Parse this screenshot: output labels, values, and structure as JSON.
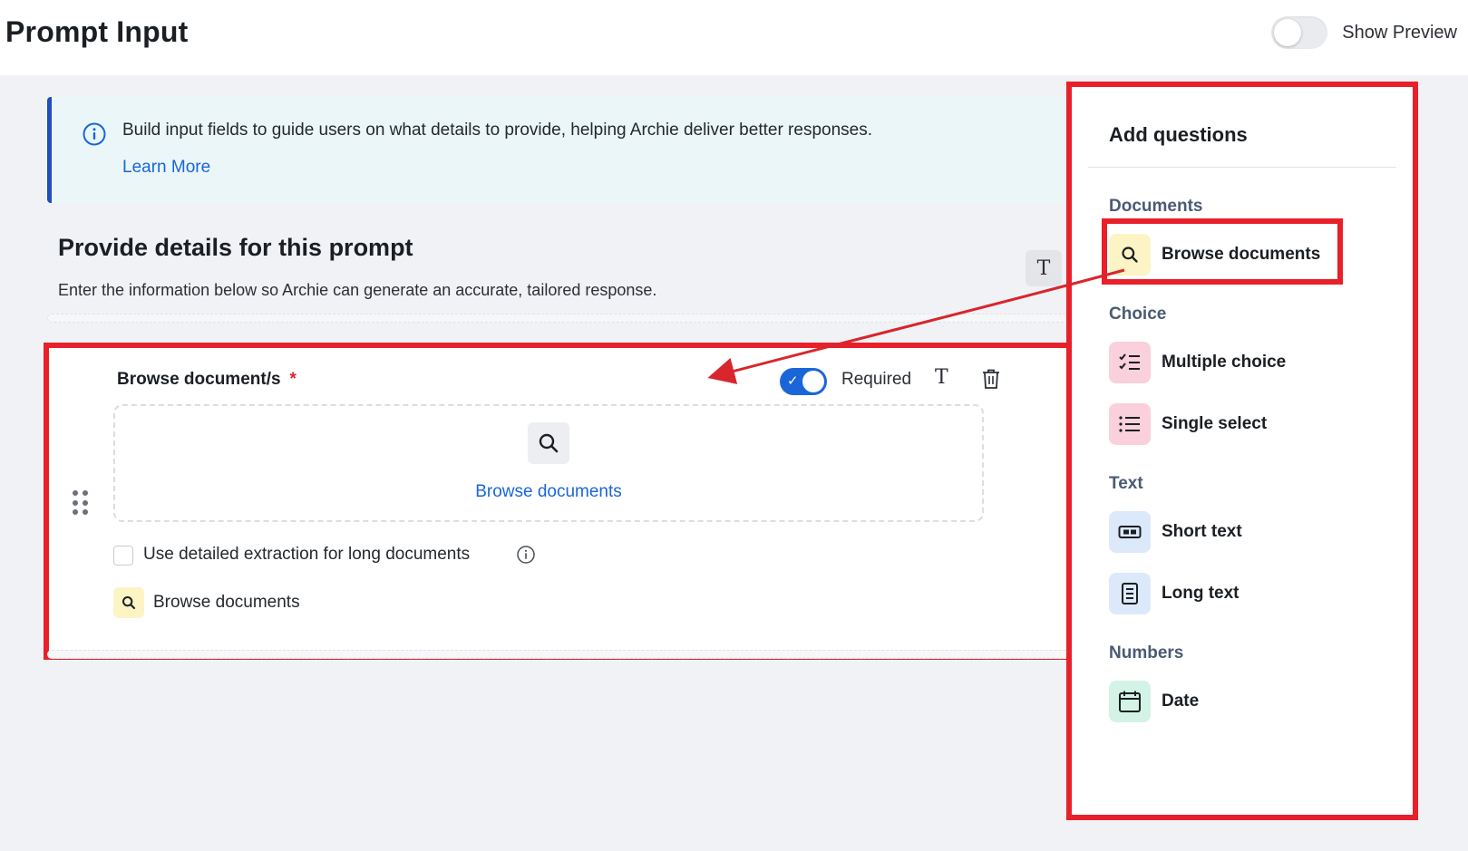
{
  "header": {
    "title": "Prompt Input",
    "preview_label": "Show Preview",
    "preview_enabled": false
  },
  "info_banner": {
    "text": "Build input fields to guide users on what details to provide, helping Archie deliver better responses.",
    "link": "Learn More"
  },
  "section": {
    "title": "Provide details for this prompt",
    "subtitle": "Enter the information below so Archie can generate an accurate, tailored response.",
    "format_button": "T"
  },
  "question": {
    "label": "Browse document/s",
    "required_marker": "*",
    "required_label": "Required",
    "required_on": true,
    "format_icon": "T",
    "drop_zone_link": "Browse documents",
    "checkbox_label": "Use detailed extraction for long documents",
    "checkbox_checked": false,
    "type_chip_label": "Browse documents"
  },
  "panel": {
    "title": "Add questions",
    "categories": [
      {
        "name": "Documents",
        "items": [
          {
            "label": "Browse documents",
            "icon": "search-icon",
            "color": "#fcf4c4"
          }
        ]
      },
      {
        "name": "Choice",
        "items": [
          {
            "label": "Multiple choice",
            "icon": "checklist-icon",
            "color": "#f9d0dc"
          },
          {
            "label": "Single select",
            "icon": "list-icon",
            "color": "#f9d0dc"
          }
        ]
      },
      {
        "name": "Text",
        "items": [
          {
            "label": "Short text",
            "icon": "text-field-icon",
            "color": "#dce9fb"
          },
          {
            "label": "Long text",
            "icon": "document-icon",
            "color": "#dce9fb"
          }
        ]
      },
      {
        "name": "Numbers",
        "items": [
          {
            "label": "Date",
            "icon": "calendar-icon",
            "color": "#d3f3e6"
          }
        ]
      }
    ]
  },
  "colors": {
    "accent": "#1a66d9",
    "annotation": "#e8202a",
    "banner_bg": "#eaf6f8"
  }
}
